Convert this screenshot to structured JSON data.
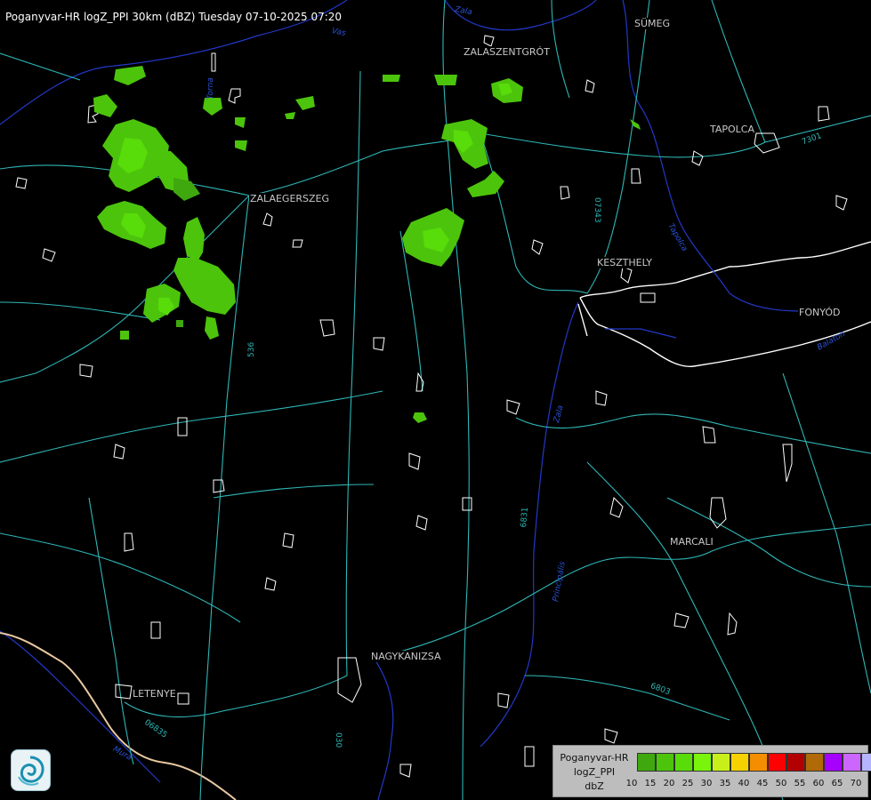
{
  "header": {
    "title": "Poganyvar-HR logZ_PPI 30km (dBZ) Tuesday 07-10-2025 07:20"
  },
  "cities": [
    {
      "name": "SÜMEG",
      "id": "sumeg"
    },
    {
      "name": "ZALASZENTGRÓT",
      "id": "zalaszentgrot"
    },
    {
      "name": "TAPOLCA",
      "id": "tapolca"
    },
    {
      "name": "ZALAEGERSZEG",
      "id": "zalaegerszeg"
    },
    {
      "name": "KESZTHELY",
      "id": "keszthely"
    },
    {
      "name": "FONYÓD",
      "id": "fonyod"
    },
    {
      "name": "MARCALI",
      "id": "marcali"
    },
    {
      "name": "NAGYKANIZSA",
      "id": "nagykanizsa"
    },
    {
      "name": "LETENYE",
      "id": "letenye"
    }
  ],
  "road_labels": [
    "7301",
    "07343",
    "536",
    "6831",
    "6803",
    "06835",
    "030"
  ],
  "river_labels": [
    "Vas",
    "Zala",
    "Torna",
    "Tapolca",
    "Balaton",
    "Principális",
    "Mura",
    "Zala"
  ],
  "legend": {
    "line1": "Poganyvar-HR",
    "line2": "logZ_PPI",
    "line3": "dbZ",
    "colors": [
      "#3fa80e",
      "#4cc40c",
      "#58dc0a",
      "#78f50b",
      "#c9ef1b",
      "#f6d200",
      "#f48e00",
      "#ff0000",
      "#b20000",
      "#b06a08",
      "#a600ff",
      "#cc66ff",
      "#b5b5ff"
    ],
    "ticks": [
      "10",
      "15",
      "20",
      "25",
      "30",
      "35",
      "40",
      "45",
      "50",
      "55",
      "60",
      "65",
      "70"
    ]
  },
  "colors": {
    "background": "#000000",
    "roads": "#2fb6b6",
    "settlements": "#ffffff",
    "rivers": "#2238c8",
    "border": "#e8c8a0"
  },
  "logo": {
    "icon": "omsz-swirl-logo-icon"
  }
}
